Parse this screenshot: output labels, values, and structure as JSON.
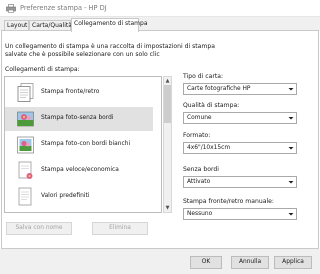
{
  "window": {
    "title": "Preferenze stampa - HP DJ"
  },
  "tabs": [
    {
      "label": "Layout"
    },
    {
      "label": "Carta/Qualità"
    },
    {
      "label": "Collegamento di stampa"
    }
  ],
  "main": {
    "description_line1": "Un collegamento di stampa è una raccolta di impostazioni di stampa",
    "description_line2": "salvate che è possibile selezionare con un solo clic",
    "list_label": "Collegamenti di stampa:",
    "shortcuts": [
      {
        "label": "Stampa fronte/retro",
        "icon": "duplex-document-icon",
        "selected": false
      },
      {
        "label": "Stampa foto-senza bordi",
        "icon": "photo-borderless-icon",
        "selected": true
      },
      {
        "label": "Stampa foto-con bordi bianchi",
        "icon": "photo-white-border-icon",
        "selected": false
      },
      {
        "label": "Stampa veloce/economica",
        "icon": "fast-economy-icon",
        "selected": false
      },
      {
        "label": "Valori predefiniti",
        "icon": "default-document-icon",
        "selected": false
      }
    ],
    "save_as_label": "Salva con nome",
    "delete_label": "Elimina"
  },
  "settings": {
    "paper_type": {
      "label": "Tipo di carta:",
      "value": "Carte fotografiche HP"
    },
    "print_quality": {
      "label": "Qualità di stampa:",
      "value": "Comune"
    },
    "format": {
      "label": "Formato:",
      "value": "4x6\"/10x15cm"
    },
    "borderless": {
      "label": "Senza bordi",
      "value": "Attivato"
    },
    "manual_duplex": {
      "label": "Stampa fronte/retro manuale:",
      "value": "Nessuno"
    }
  },
  "footer": {
    "ok_label": "OK",
    "cancel_label": "Annulla",
    "apply_label": "Applica"
  },
  "colors": {
    "selection": "#e1e1e1",
    "photo_sky": "#9bc8e8",
    "photo_flower": "#e0608a",
    "photo_leaf": "#4c9a3a"
  }
}
